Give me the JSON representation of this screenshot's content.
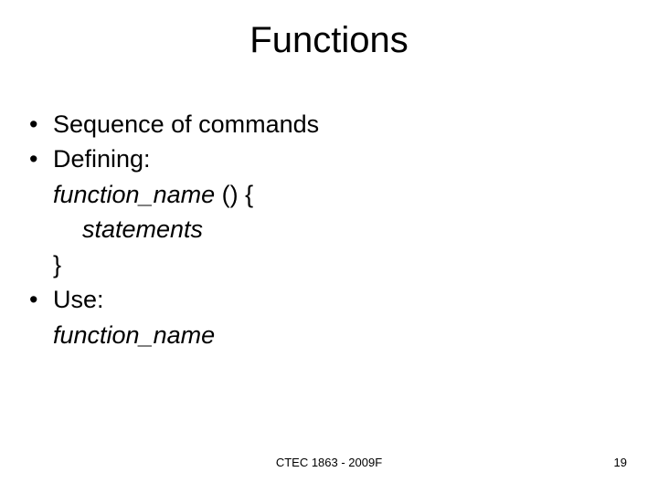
{
  "title": "Functions",
  "bullets": {
    "b1": "Sequence of commands",
    "b2": "Defining:",
    "b2_line1_italic": "function_name",
    "b2_line1_rest": "  () {",
    "b2_line2": "statements",
    "b2_line3": "}",
    "b3": "Use:",
    "b3_line1": "function_name"
  },
  "footer": {
    "center": "CTEC 1863 - 2009F",
    "page": "19"
  }
}
